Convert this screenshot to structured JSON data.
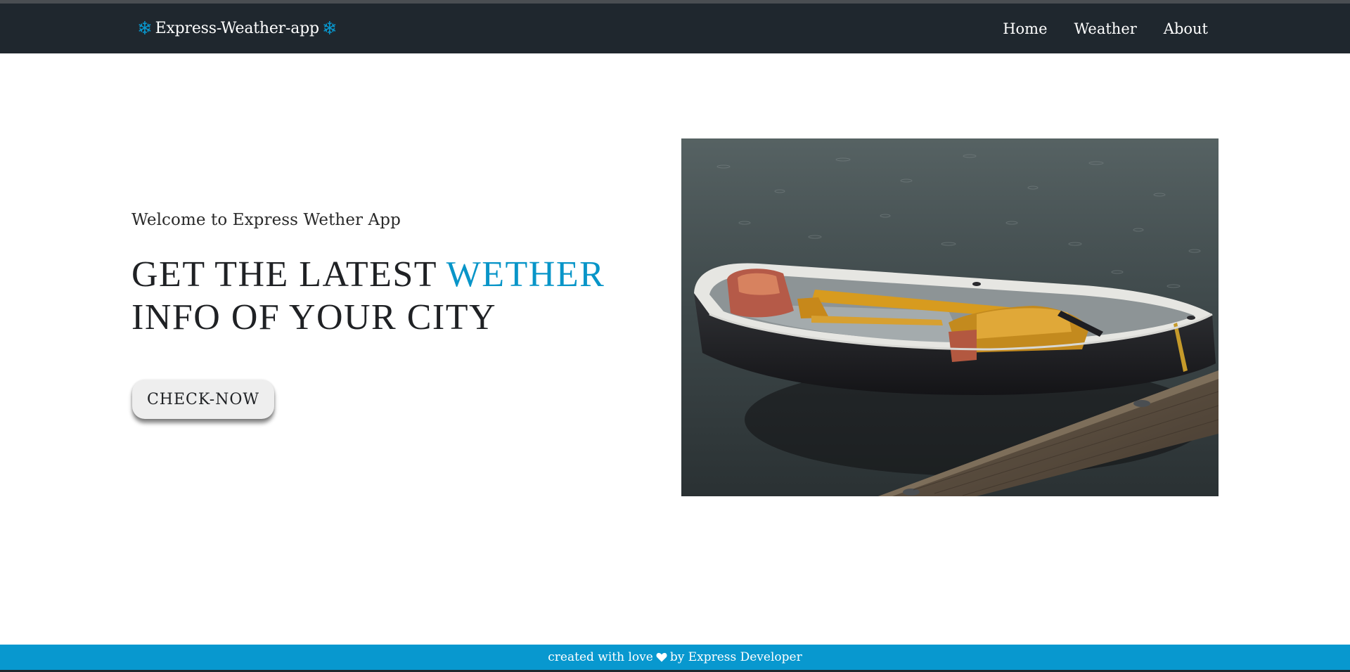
{
  "navbar": {
    "brand": "Express-Weather-app",
    "brand_icon": "snowflake-icon",
    "links": [
      "Home",
      "Weather",
      "About"
    ]
  },
  "hero": {
    "welcome": "Welcome to Express Wether App",
    "headline_part1": "GET THE LATEST ",
    "headline_accent": "WETHER",
    "headline_part2": "INFO OF YOUR CITY",
    "button_label": "CHECK-NOW"
  },
  "footer": {
    "text_before": "created with love",
    "icon": "heart-icon",
    "text_after": "by Express Developer"
  },
  "colors": {
    "navbar_bg": "#1f272e",
    "accent": "#0898cf",
    "footer_bg": "#0898cf",
    "button_bg": "#eeeeee"
  }
}
